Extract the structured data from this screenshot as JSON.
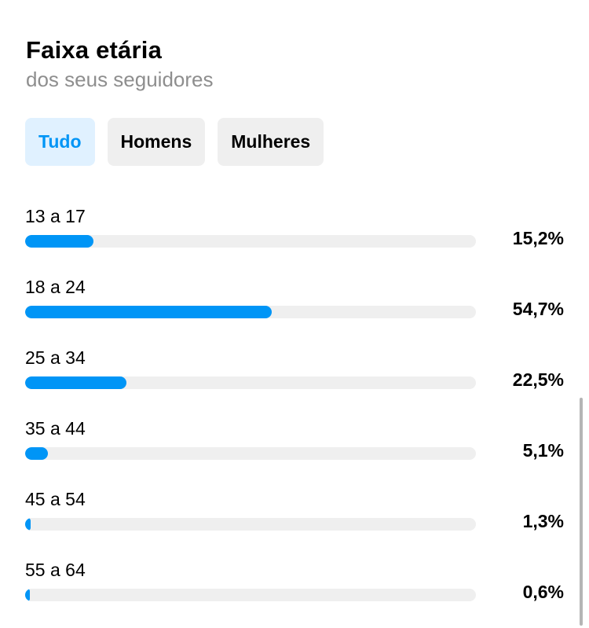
{
  "header": {
    "title": "Faixa etária",
    "subtitle": "dos seus seguidores"
  },
  "filters": [
    {
      "label": "Tudo",
      "active": true
    },
    {
      "label": "Homens",
      "active": false
    },
    {
      "label": "Mulheres",
      "active": false
    }
  ],
  "age_ranges": [
    {
      "label": "13 a 17",
      "value": "15,2%",
      "percent": 15.2
    },
    {
      "label": "18 a 24",
      "value": "54,7%",
      "percent": 54.7
    },
    {
      "label": "25 a 34",
      "value": "22,5%",
      "percent": 22.5
    },
    {
      "label": "35 a 44",
      "value": "5,1%",
      "percent": 5.1
    },
    {
      "label": "45 a 54",
      "value": "1,3%",
      "percent": 1.3
    },
    {
      "label": "55 a 64",
      "value": "0,6%",
      "percent": 0.6
    }
  ],
  "colors": {
    "accent": "#0095f6",
    "track": "#efefef",
    "active_chip_bg": "#e0f1ff",
    "chip_bg": "#efefef",
    "subtitle": "#8e8e8e"
  }
}
